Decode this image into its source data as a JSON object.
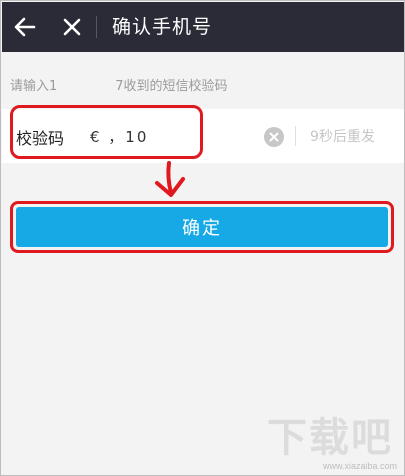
{
  "header": {
    "title": "确认手机号",
    "back_icon": "arrow-left-icon",
    "close_icon": "close-icon"
  },
  "hint": {
    "prefix": "请输入1",
    "suffix": "7收到的短信校验码"
  },
  "code_field": {
    "label": "校验码",
    "value": "€ ，10",
    "resend_label": "9秒后重发",
    "clear_icon": "clear-circle-icon"
  },
  "confirm": {
    "label": "确定"
  },
  "watermark": {
    "text": "下载吧",
    "url": "www.xiazaiba.com"
  },
  "colors": {
    "topbar": "#2a2b36",
    "primary": "#17a9e6",
    "annotation": "#e0191f"
  }
}
